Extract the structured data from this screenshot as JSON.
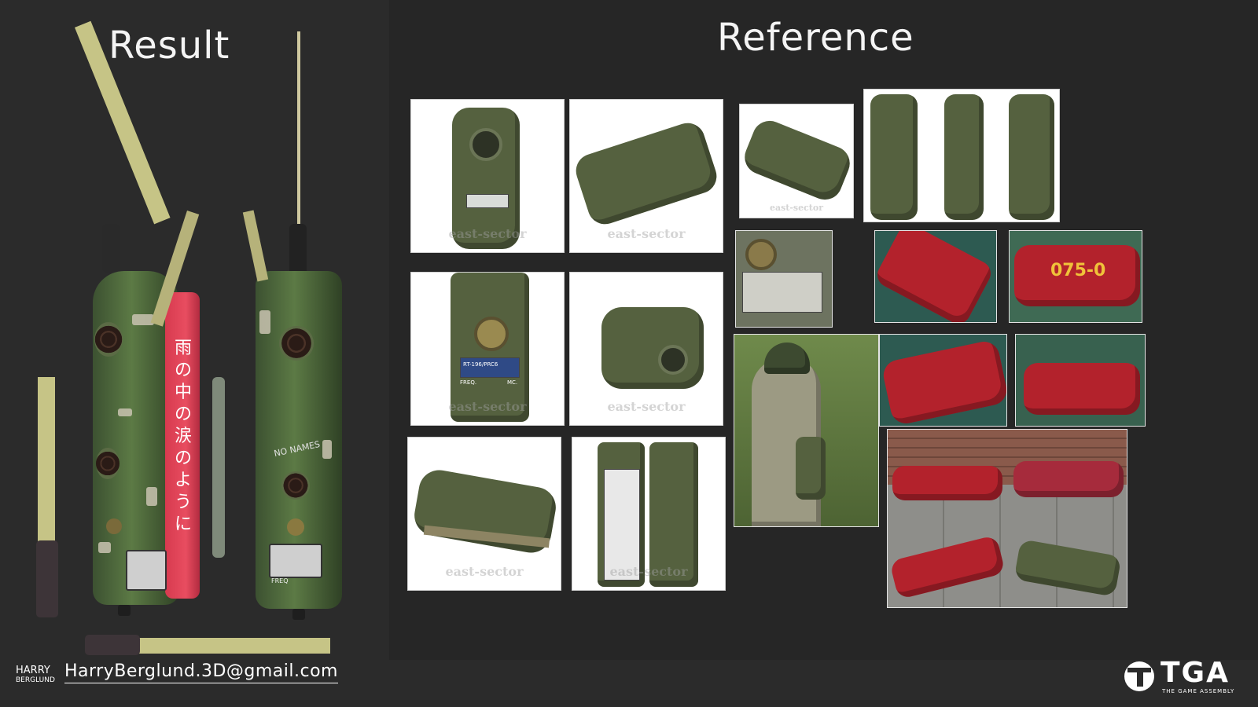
{
  "headings": {
    "result": "Result",
    "reference": "Reference"
  },
  "watermark": "east-sector",
  "model_text": {
    "no_names": "NO NAMES",
    "freq": "FREQ",
    "kanji_lines": [
      "雨",
      "の",
      "中",
      "の",
      "涙",
      "の",
      "よ",
      "う",
      "に"
    ]
  },
  "photo_text": {
    "unit_code": "075-0",
    "plate_model": "RT-196/PRC6",
    "plate_freq": "FREQ.",
    "plate_mc": "MC."
  },
  "footer": {
    "name_first": "HARRY",
    "name_last": "BERGLUND",
    "email": "HarryBerglund.3D@gmail.com"
  },
  "logo": {
    "text": "TGA",
    "subtitle": "THE GAME ASSEMBLY"
  },
  "colors": {
    "background": "#2b2b2b",
    "olive": "#55613f",
    "red": "#b3222c",
    "text": "#f2f2f2"
  }
}
